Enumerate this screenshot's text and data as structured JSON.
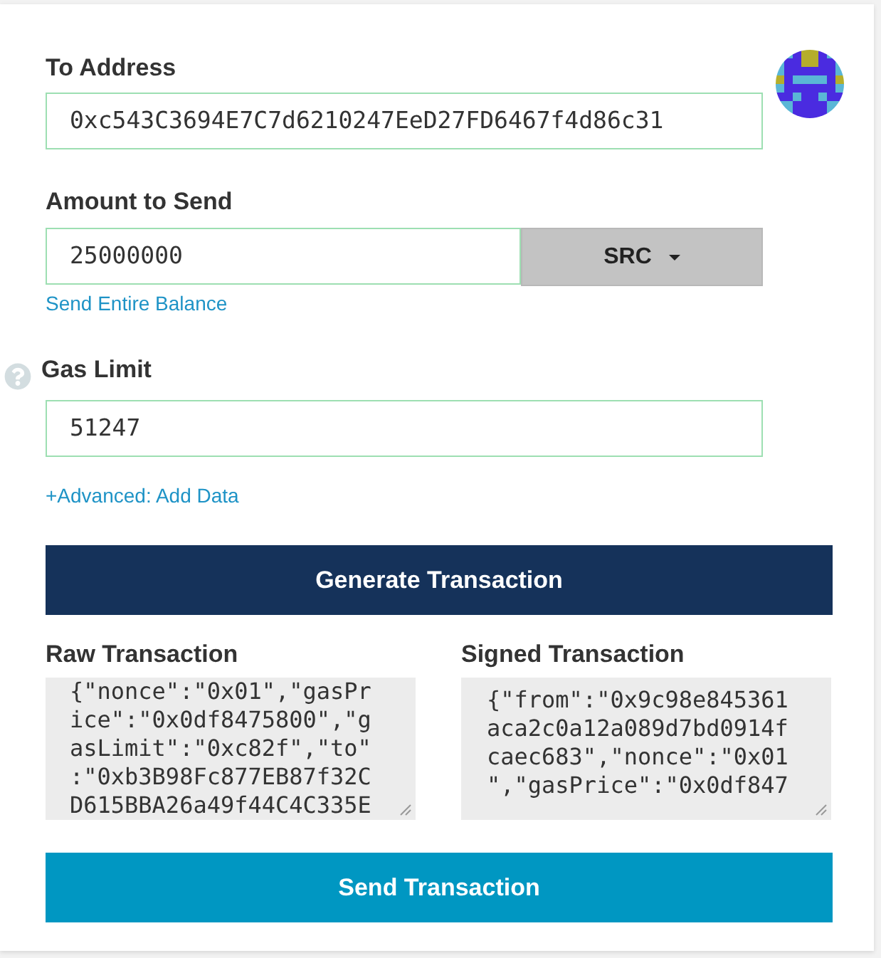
{
  "to_address": {
    "label": "To Address",
    "value": "0xc543C3694E7C7d6210247EeD27FD6467f4d86c31"
  },
  "amount": {
    "label": "Amount to Send",
    "value": "25000000",
    "unit": "SRC",
    "balance_link": "Send Entire Balance"
  },
  "gas_limit": {
    "label": "Gas Limit",
    "value": "51247"
  },
  "advanced_link": "+Advanced: Add Data",
  "generate_button": "Generate Transaction",
  "raw_transaction": {
    "label": "Raw Transaction",
    "lines": [
      "{\"nonce\":\"0x01\",\"gasPr",
      "ice\":\"0x0df8475800\",\"g",
      "asLimit\":\"0xc82f\",\"to\"",
      ":\"0xb3B98Fc877EB87f32C",
      "D615BBA26a49f44C4C335E"
    ]
  },
  "signed_transaction": {
    "label": "Signed Transaction",
    "lines": [
      "{\"from\":\"0x9c98e845361",
      "aca2c0a12a089d7bd0914f",
      "caec683\",\"nonce\":\"0x01",
      "\",\"gasPrice\":\"0x0df847"
    ]
  },
  "send_button": "Send Transaction"
}
